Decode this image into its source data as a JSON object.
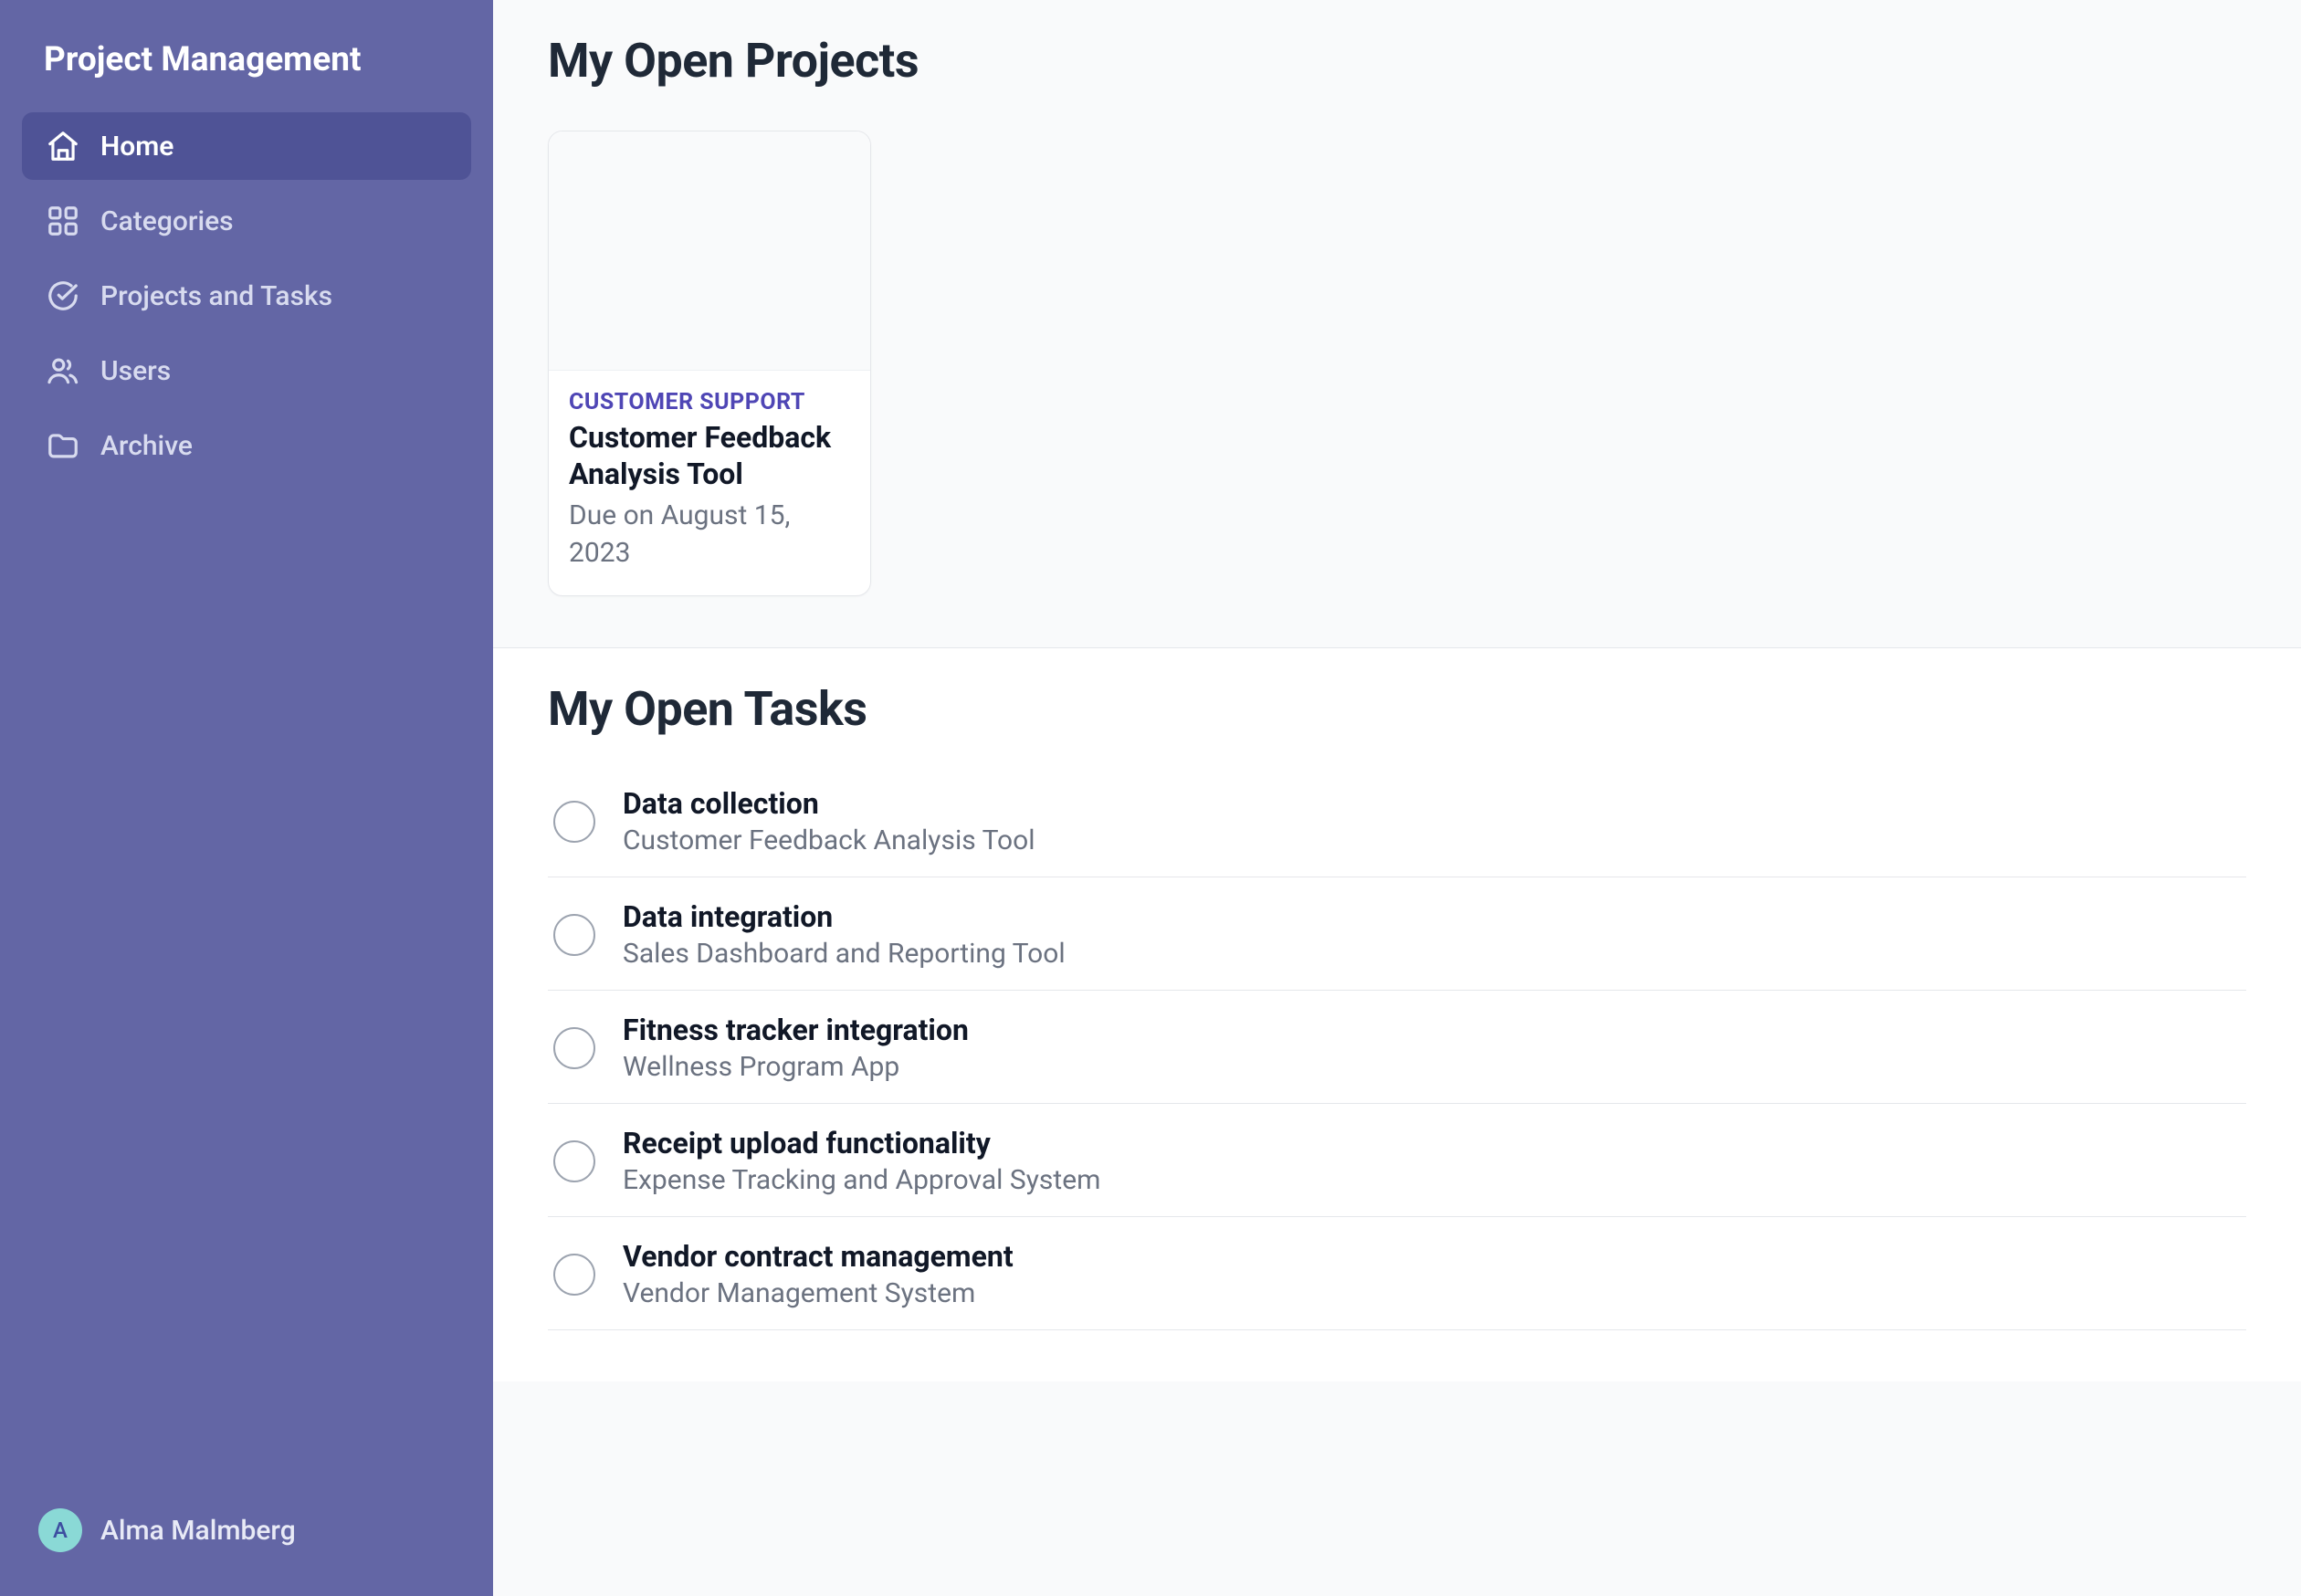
{
  "sidebar": {
    "title": "Project Management",
    "nav": [
      {
        "label": "Home",
        "icon": "home",
        "active": true
      },
      {
        "label": "Categories",
        "icon": "grid",
        "active": false
      },
      {
        "label": "Projects and Tasks",
        "icon": "check-circle",
        "active": false
      },
      {
        "label": "Users",
        "icon": "users",
        "active": false
      },
      {
        "label": "Archive",
        "icon": "folder",
        "active": false
      }
    ],
    "user": {
      "initial": "A",
      "name": "Alma Malmberg"
    }
  },
  "projectsSection": {
    "title": "My Open Projects",
    "cards": [
      {
        "category": "CUSTOMER SUPPORT",
        "name": "Customer Feedback Analysis Tool",
        "due": "Due on August 15, 2023"
      }
    ]
  },
  "tasksSection": {
    "title": "My Open Tasks",
    "tasks": [
      {
        "title": "Data collection",
        "project": "Customer Feedback Analysis Tool"
      },
      {
        "title": "Data integration",
        "project": "Sales Dashboard and Reporting Tool"
      },
      {
        "title": "Fitness tracker integration",
        "project": "Wellness Program App"
      },
      {
        "title": "Receipt upload functionality",
        "project": "Expense Tracking and Approval System"
      },
      {
        "title": "Vendor contract management",
        "project": "Vendor Management System"
      }
    ]
  }
}
